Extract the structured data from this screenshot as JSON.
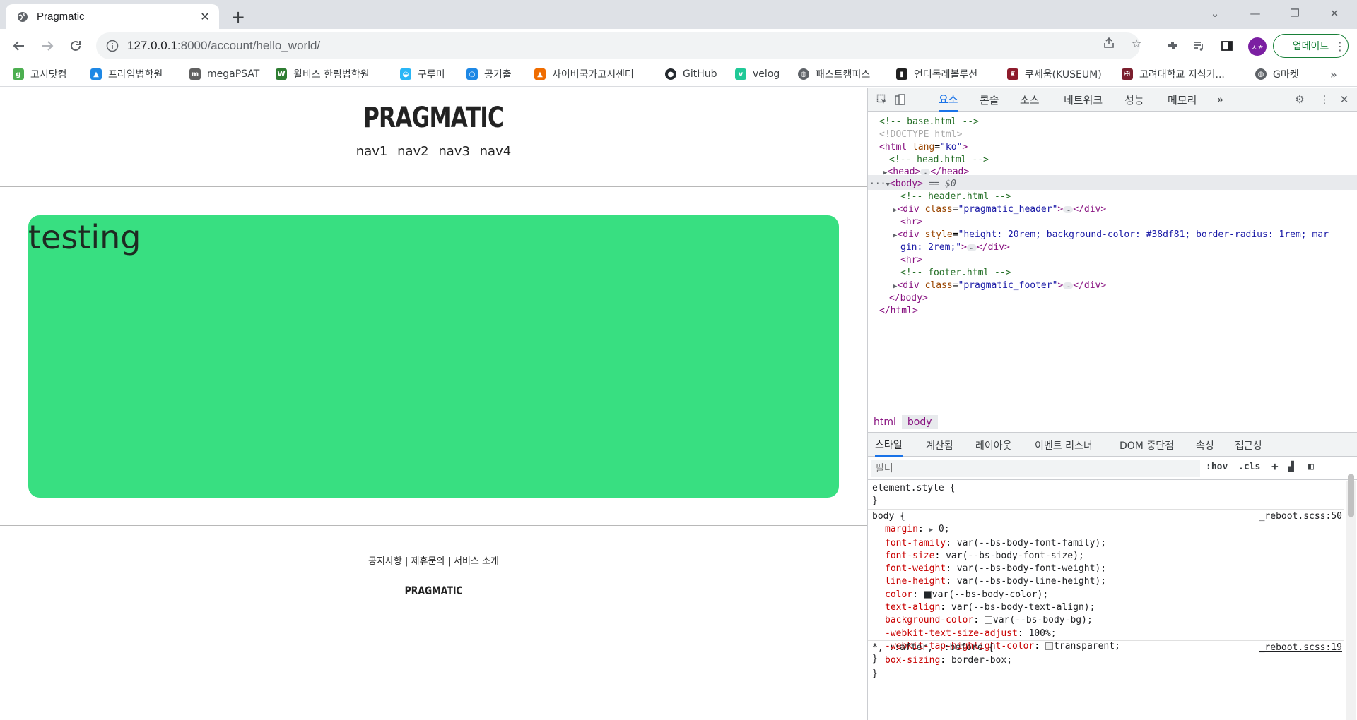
{
  "browser": {
    "tab_title": "Pragmatic",
    "url_host": "127.0.0.1",
    "url_rest": ":8000/account/hello_world/",
    "update_label": "업데이트",
    "profile_initials": "ㅅㅎ"
  },
  "bookmarks": [
    {
      "label": "고시닷컴",
      "color": "#4caf50"
    },
    {
      "label": "프라임법학원",
      "color": "#1e88e5"
    },
    {
      "label": "megaPSAT",
      "color": "#616161"
    },
    {
      "label": "윌비스 한림법학원",
      "color": "#2e7d32"
    },
    {
      "label": "구루미",
      "color": "#29b6f6"
    },
    {
      "label": "공기출",
      "color": "#1e88e5"
    },
    {
      "label": "사이버국가고시센터",
      "color": "#ef6c00"
    },
    {
      "label": "GitHub",
      "color": "#24292e"
    },
    {
      "label": "velog",
      "color": "#20c997"
    },
    {
      "label": "패스트캠퍼스",
      "color": "#5f6368"
    },
    {
      "label": "언더독레볼루션",
      "color": "#212121"
    },
    {
      "label": "쿠세움(KUSEUM)",
      "color": "#8e1b2c"
    },
    {
      "label": "고려대학교 지식기...",
      "color": "#7b1f2e"
    },
    {
      "label": "G마켓",
      "color": "#5f6368"
    }
  ],
  "page": {
    "logo": "PRAGMATIC",
    "navs": [
      "nav1",
      "nav2",
      "nav3",
      "nav4"
    ],
    "content_text": "testing",
    "content_bg": "#38df81",
    "footer_links": "공지사항 | 제휴문의 | 서비스 소개",
    "footer_logo": "PRAGMATIC"
  },
  "devtools": {
    "tabs": [
      "요소",
      "콘솔",
      "소스",
      "네트워크",
      "성능",
      "메모리"
    ],
    "more_tabs": "»",
    "dom": {
      "c_base": "<!-- base.html -->",
      "doctype": "<!DOCTYPE html>",
      "html_open_tag": "<html",
      "html_lang_attr": "lang",
      "html_lang_val": "\"ko\"",
      "close_gt": ">",
      "c_head": "<!-- head.html -->",
      "head_open": "<head>",
      "head_close": "</head>",
      "body_open": "<body>",
      "body_eq": " == $0",
      "c_header": "<!-- header.html -->",
      "div_open": "<div",
      "class_attr": "class",
      "header_class_val": "\"pragmatic_header\"",
      "div_close": "</div>",
      "hr": "<hr>",
      "style_attr": "style",
      "style_val_1": "\"height: 20rem; background-color: #38df81; border-radius: 1rem; mar",
      "style_val_2": "gin: 2rem;\"",
      "c_footer": "<!-- footer.html -->",
      "footer_class_val": "\"pragmatic_footer\"",
      "body_close": "</body>",
      "html_close": "</html>",
      "ellipsis": "…",
      "dots": "···"
    },
    "crumbs": [
      "html",
      "body"
    ],
    "style_tabs": [
      "스타일",
      "계산됨",
      "레이아웃",
      "이벤트 리스너",
      "DOM 중단점",
      "속성",
      "접근성"
    ],
    "filter_placeholder": "필터",
    "hov": ":hov",
    "cls": ".cls",
    "element_style": "element.style {",
    "close_brace": "}",
    "body_rule": {
      "selector": "body {",
      "source": "_reboot.scss:50",
      "props": [
        {
          "name": "margin",
          "value": "0;",
          "arrow": true
        },
        {
          "name": "font-family",
          "value": "var(--bs-body-font-family);"
        },
        {
          "name": "font-size",
          "value": "var(--bs-body-font-size);"
        },
        {
          "name": "font-weight",
          "value": "var(--bs-body-font-weight);"
        },
        {
          "name": "line-height",
          "value": "var(--bs-body-line-height);"
        },
        {
          "name": "color",
          "value": "var(--bs-body-color);",
          "swatch": "#212529"
        },
        {
          "name": "text-align",
          "value": "var(--bs-body-text-align);"
        },
        {
          "name": "background-color",
          "value": "var(--bs-body-bg);",
          "swatch": "#ffffff"
        },
        {
          "name": "-webkit-text-size-adjust",
          "value": "100%;"
        },
        {
          "name": "-webkit-tap-highlight-color",
          "value": "transparent;",
          "swatch": "#f2f2f2"
        }
      ]
    },
    "star_rule": {
      "selector": "*, ::after, ::before {",
      "source": "_reboot.scss:19",
      "props": [
        {
          "name": "box-sizing",
          "value": "border-box;"
        }
      ]
    }
  }
}
